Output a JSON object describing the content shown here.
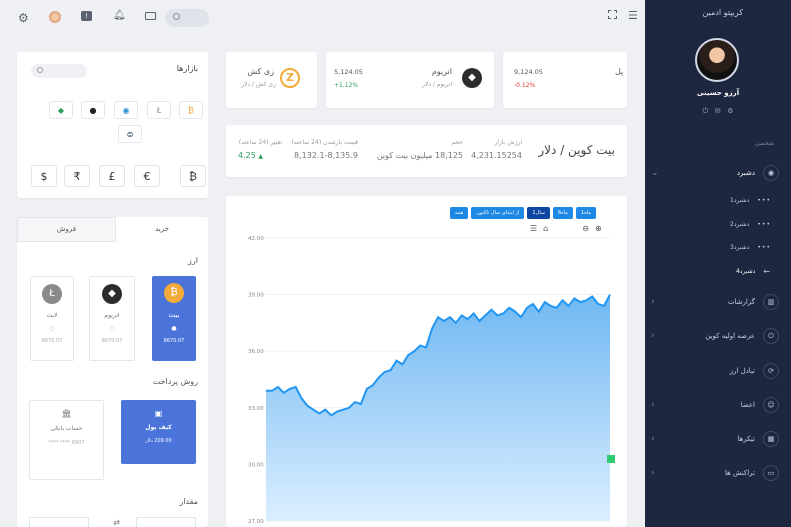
{
  "sidebar": {
    "brand": "کریپتو ادمین",
    "user_name": "آرزو حسینی",
    "section_label": "شخصی",
    "dashboard_label": "دشبرد",
    "sub_items": [
      "دشبرد1",
      "دشبرد2",
      "دشبرد3",
      "دشبرد4"
    ],
    "items": [
      {
        "label": "گزارشات",
        "icon": "chart-icon"
      },
      {
        "label": "عرضه اولیه کوین",
        "icon": "power-icon"
      },
      {
        "label": "تبادل ارز",
        "icon": "exchange-icon"
      },
      {
        "label": "اعضا",
        "icon": "user-icon"
      },
      {
        "label": "تیکرها",
        "icon": "ticket-icon"
      },
      {
        "label": "تراکنش ها",
        "icon": "wallet-icon"
      }
    ]
  },
  "stats": [
    {
      "name": "زی کش",
      "sub": "زی کش / دلار",
      "value": "",
      "change": ""
    },
    {
      "name": "اتریوم",
      "sub": "اتریوم / دلار",
      "value": "5,124.05",
      "change": "+1.12%"
    },
    {
      "name": "پل",
      "sub": "",
      "value": "9,124.05",
      "change": "-0.12%"
    }
  ],
  "ticker": {
    "pair": "بیت کوین / دلار",
    "labels": [
      "ارزش بازار",
      "حجم",
      "قیمت بازشدن (24 ساعته)",
      "تغییر (24 ساعته)"
    ],
    "values": [
      "4,231.15254",
      "18,125 میلیون بیت کوین",
      "8,132.1-8,135.9",
      "4.25"
    ]
  },
  "markets": {
    "title": "بازارها",
    "currency_symbols": [
      "$",
      "₹",
      "£",
      "€",
      "₿"
    ]
  },
  "trade": {
    "tabs": [
      "خرید",
      "فروش"
    ],
    "currency_title": "ارز",
    "coins": [
      {
        "name": "بیت",
        "amount": "8670.07"
      },
      {
        "name": "اتریوم",
        "amount": "8670.07"
      },
      {
        "name": "لایت",
        "amount": "8670.07"
      }
    ],
    "payment_title": "روش پرداخت",
    "wallet_label": "کیف پول",
    "wallet_amount": "209.00 دلار",
    "bank_label": "حساب بانکی",
    "bank_number": "**** **** 6907",
    "amount_title": "مقدار"
  },
  "chart_buttons": [
    "1ماه",
    "6ماه",
    "1سال",
    "از ابتدای سال تاکنون",
    "همه"
  ],
  "chart_data": {
    "type": "area",
    "yticks": [
      "27.00",
      "30.00",
      "33.00",
      "36.00",
      "39.00",
      "42.00"
    ],
    "ylim": [
      27,
      42
    ],
    "color": "#2196f3",
    "values": [
      33.9,
      33.9,
      34.1,
      33.8,
      34.0,
      34.1,
      33.5,
      33.1,
      32.9,
      32.7,
      32.9,
      32.6,
      32.8,
      32.9,
      33.0,
      33.3,
      33.2,
      34.0,
      34.2,
      34.6,
      34.9,
      35.0,
      35.5,
      35.3,
      35.8,
      36.0,
      36.3,
      36.2,
      37.2,
      37.8,
      37.6,
      37.8,
      37.5,
      37.9,
      37.7,
      38.0,
      37.6,
      37.9,
      38.2,
      37.9,
      38.0,
      38.3,
      38.1,
      37.8,
      38.3,
      38.5,
      38.1,
      38.6,
      38.4,
      38.3,
      38.7,
      38.4,
      38.8,
      38.6,
      38.7,
      38.9,
      38.5,
      38.4,
      39.0
    ]
  },
  "colors": {
    "sidebar": "#1e2740",
    "accent": "#2196f3",
    "positive": "#2e9e5b",
    "negative": "#e53935"
  }
}
